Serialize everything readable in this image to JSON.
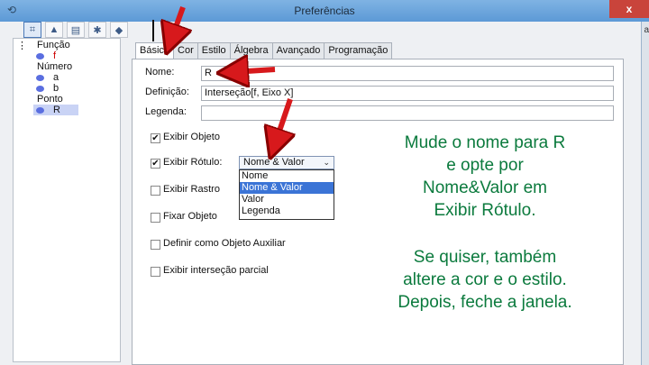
{
  "window": {
    "title": "Preferências",
    "close": "x"
  },
  "toolbar": {
    "buttons": [
      "geometry",
      "graphics",
      "layout",
      "gear",
      "styles"
    ]
  },
  "tree": {
    "items": [
      {
        "label": "Função",
        "child": "f"
      },
      {
        "label": "Número",
        "children": [
          "a",
          "b"
        ]
      },
      {
        "label": "Ponto",
        "child": "R"
      }
    ]
  },
  "side": {
    "letter": "a"
  },
  "tabs": [
    "Básico",
    "Cor",
    "Estilo",
    "Álgebra",
    "Avançado",
    "Programação"
  ],
  "form": {
    "name_label": "Nome:",
    "name_value": "R",
    "definition_label": "Definição:",
    "definition_value": "Interseção[f, Eixo X]",
    "caption_label": "Legenda:",
    "caption_value": ""
  },
  "checks": [
    {
      "label": "Exibir Objeto",
      "checked": true
    },
    {
      "label": "Exibir Rótulo:",
      "checked": true
    },
    {
      "label": "Exibir Rastro",
      "checked": false
    },
    {
      "label": "Fixar Objeto",
      "checked": false
    },
    {
      "label": "Definir como Objeto Auxiliar",
      "checked": false
    },
    {
      "label": "Exibir interseção parcial",
      "checked": false
    }
  ],
  "label_dropdown": {
    "selected": "Nome & Valor",
    "options": [
      "Nome",
      "Nome & Valor",
      "Valor",
      "Legenda"
    ]
  },
  "notes": {
    "line1": "Mude o nome para R",
    "line2": "e opte por",
    "line3": "Nome&Valor em",
    "line4": "Exibir Rótulo.",
    "line5": "Se quiser, também",
    "line6": "altere a cor e o estilo.",
    "line7": "Depois, feche a janela."
  },
  "colors": {
    "note": "#0b7a3d",
    "arrow": "#d7191c",
    "selection": "#3b74d6"
  }
}
